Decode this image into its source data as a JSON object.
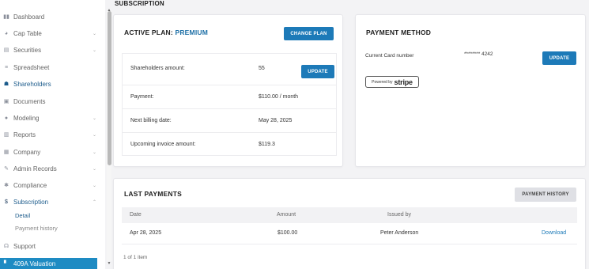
{
  "page": {
    "title": "SUBSCRIPTION"
  },
  "sidebar": {
    "items": [
      {
        "label": "Dashboard",
        "icon": "bars-icon",
        "glyph": "▮▮"
      },
      {
        "label": "Cap Table",
        "icon": "pie-chart-icon",
        "glyph": "◕"
      },
      {
        "label": "Securities",
        "icon": "document-icon",
        "glyph": "▤"
      },
      {
        "label": "Spreadsheet",
        "icon": "list-icon",
        "glyph": "≡"
      },
      {
        "label": "Shareholders",
        "icon": "person-icon",
        "glyph": "☗"
      },
      {
        "label": "Documents",
        "icon": "folder-icon",
        "glyph": "▣"
      },
      {
        "label": "Modeling",
        "icon": "bulb-icon",
        "glyph": "●"
      },
      {
        "label": "Reports",
        "icon": "report-icon",
        "glyph": "▥"
      },
      {
        "label": "Company",
        "icon": "building-icon",
        "glyph": "▦"
      },
      {
        "label": "Admin Records",
        "icon": "pen-icon",
        "glyph": "✎"
      },
      {
        "label": "Compliance",
        "icon": "shield-icon",
        "glyph": "✱"
      },
      {
        "label": "Subscription",
        "icon": "dollar-icon",
        "glyph": "$"
      },
      {
        "label": "Support",
        "icon": "support-icon",
        "glyph": "☊"
      }
    ],
    "sub_items": [
      "Detail",
      "Payment history"
    ],
    "bottom_item": {
      "label": "409A Valuation",
      "icon": "valuation-icon",
      "glyph": "▘"
    }
  },
  "plan_card": {
    "title": "ACTIVE PLAN:",
    "plan": "PREMIUM",
    "change_label": "CHANGE PLAN",
    "update_label": "UPDATE",
    "rows": [
      {
        "label": "Shareholders amount:",
        "value": "55"
      },
      {
        "label": "Payment:",
        "value": "$110.00 / month"
      },
      {
        "label": "Next billing date:",
        "value": "May 28, 2025"
      },
      {
        "label": "Upcoming invoice amount:",
        "value": "$119.3"
      }
    ]
  },
  "payment_card": {
    "title": "PAYMENT METHOD",
    "card_label": "Current Card number",
    "card_value": "******** 4242",
    "update_label": "UPDATE",
    "stripe_powered": "Powered by",
    "stripe_brand": "stripe"
  },
  "last_payments": {
    "title": "LAST PAYMENTS",
    "history_label": "PAYMENT HISTORY",
    "columns": [
      "Date",
      "Amount",
      "Issued by"
    ],
    "rows": [
      {
        "date": "Apr 28, 2025",
        "amount": "$100.00",
        "issued_by": "Peter Anderson",
        "action": "Download"
      }
    ],
    "footer": "1 of 1 item"
  },
  "colors": {
    "accent": "#1d7ab8",
    "active_nav": "#1d5c8c",
    "highlight": "#1e8bc3"
  }
}
